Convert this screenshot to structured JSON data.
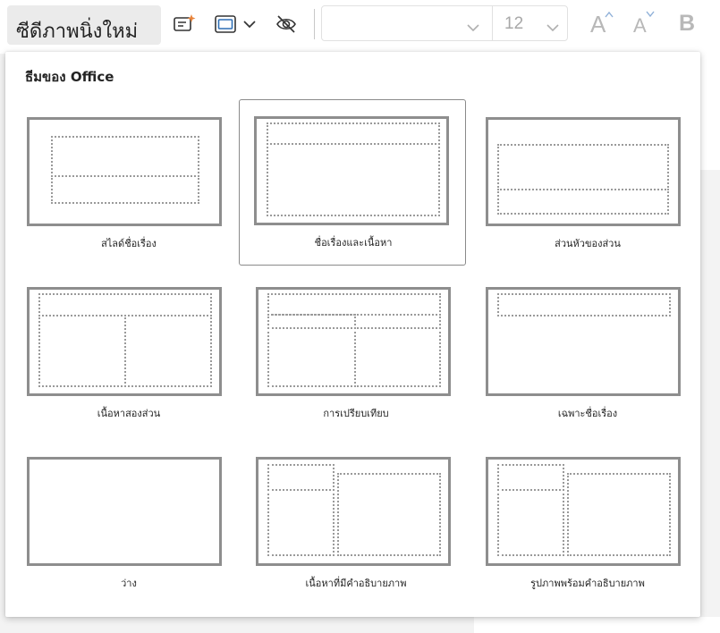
{
  "toolbar": {
    "new_slide_label": "ซีดีภาพนิ่งใหม่",
    "font_size": "12",
    "increase_font": "A",
    "decrease_font": "A",
    "bold": "B",
    "icons": [
      "designer-icon",
      "layout-icon",
      "chevron-down-icon",
      "hide-slide-icon"
    ]
  },
  "popup": {
    "title": "ธีมของ Office",
    "layouts": [
      {
        "label": "สไลด์ชื่อเรื่อง",
        "selected": false
      },
      {
        "label": "ชื่อเรื่องและเนื้อหา",
        "selected": true
      },
      {
        "label": "ส่วนหัวของส่วน",
        "selected": false
      },
      {
        "label": "เนื้อหาสองส่วน",
        "selected": false
      },
      {
        "label": "การเปรียบเทียบ",
        "selected": false
      },
      {
        "label": "เฉพาะชื่อเรื่อง",
        "selected": false
      },
      {
        "label": "ว่าง",
        "selected": false
      },
      {
        "label": "เนื้อหาที่มีคำอธิบายภาพ",
        "selected": false
      },
      {
        "label": "รูปภาพพร้อมคำอธิบายภาพ",
        "selected": false
      }
    ]
  },
  "colors": {
    "accent_orange": "#e8833a",
    "icon_blue": "#2f6fb6",
    "border_selected": "#8a8a8a"
  }
}
